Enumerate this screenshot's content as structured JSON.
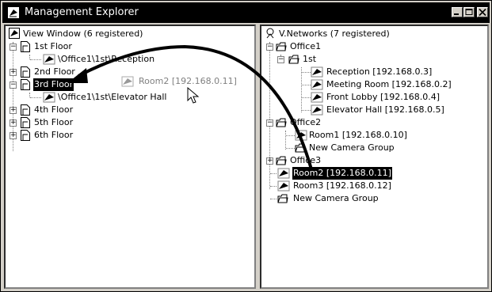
{
  "window": {
    "title": "Management Explorer"
  },
  "left_tree": {
    "root": "View Window (6 registered)",
    "floors": [
      {
        "label": "1st Floor",
        "child": "\\Office1\\1st\\Reception"
      },
      {
        "label": "2nd Floor"
      },
      {
        "label": "3rd Floor",
        "child": "\\Office1\\1st\\Elevator Hall"
      },
      {
        "label": "4th Floor"
      },
      {
        "label": "5th Floor"
      },
      {
        "label": "6th Floor"
      }
    ],
    "drag_ghost": "Room2 [192.168.0.11]"
  },
  "right_tree": {
    "root": "V.Networks (7 registered)",
    "office1": "Office1",
    "office1_sub": "1st",
    "cameras_1st": [
      "Reception [192.168.0.3]",
      "Meeting Room [192.168.0.2]",
      "Front Lobby [192.168.0.4]",
      "Elevator Hall [192.168.0.5]"
    ],
    "office2": "Office2",
    "office2_items": [
      "Room1 [192.168.0.10]",
      "New Camera Group"
    ],
    "office3": "Office3",
    "loose_items": [
      "Room2 [192.168.0.11]",
      "Room3 [192.168.0.12]",
      "New Camera Group"
    ]
  },
  "icons": [
    "camera-icon",
    "page-icon",
    "folder-icon",
    "network-icon",
    "mouse-cursor-icon"
  ],
  "colors": {
    "title_bar": "#000000",
    "selection": "#000000",
    "window_frame": "#d4d0c8",
    "arrow": "#000000"
  }
}
